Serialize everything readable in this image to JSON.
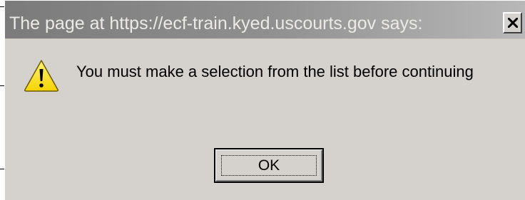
{
  "dialog": {
    "title": "The page at https://ecf-train.kyed.uscourts.gov says:",
    "message": "You must make a selection from the list before continuing",
    "icon": "warning-icon",
    "ok_label": "OK",
    "close_icon": "close-icon"
  },
  "colors": {
    "dialog_background": "#d5d1cc",
    "titlebar_start": "#7b7b7b",
    "titlebar_end": "#b8b8b8",
    "title_text": "#ebeae6",
    "warning_fill": "#f5d400"
  }
}
